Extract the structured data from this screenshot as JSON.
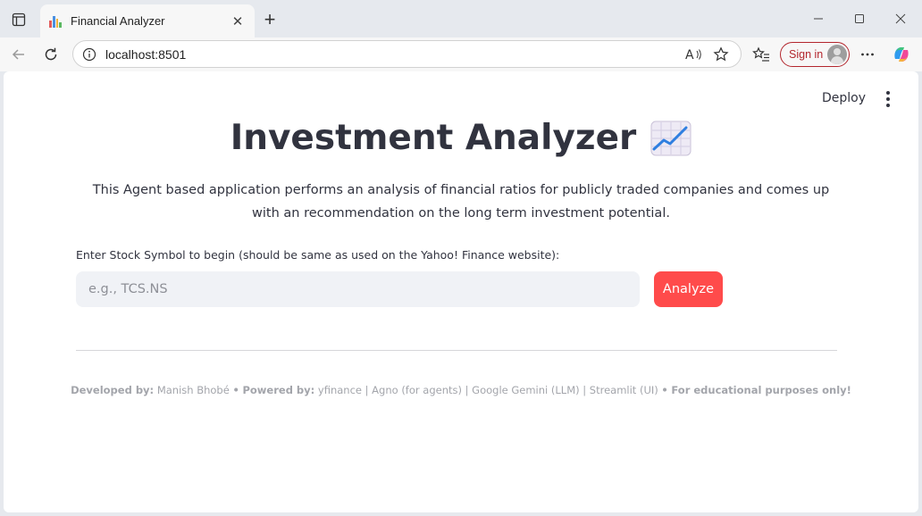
{
  "browser": {
    "tab": {
      "title": "Financial Analyzer",
      "close": "✕"
    },
    "new_tab": "+",
    "window": {
      "minimize": "–",
      "maximize": "□",
      "close": "✕"
    },
    "address": {
      "url": "localhost:8501"
    },
    "sign_in_label": "Sign in"
  },
  "app": {
    "deploy_label": "Deploy",
    "title": "Investment Analyzer",
    "title_emoji": "chart-increasing-icon",
    "subtitle": "This Agent based application performs an analysis of financial ratios for publicly traded companies and comes up with an recommendation on the long term investment potential.",
    "input": {
      "label": "Enter Stock Symbol to begin (should be same as used on the Yahoo! Finance website):",
      "placeholder": "e.g., TCS.NS",
      "value": ""
    },
    "analyze_label": "Analyze",
    "footer": {
      "developed_by_label": "Developed by:",
      "developer": "Manish Bhobé",
      "sep1": "•",
      "powered_by_label": "Powered by:",
      "stack": "yfinance | Agno (for agents) | Google Gemini (LLM) | Streamlit (UI)",
      "sep2": "•",
      "disclaimer": "For educational purposes only!"
    }
  },
  "colors": {
    "accent": "#ff4b4b",
    "text": "#31333f",
    "input_bg": "#f0f2f6",
    "muted": "#a3a5ab",
    "signin": "#b3262d"
  }
}
